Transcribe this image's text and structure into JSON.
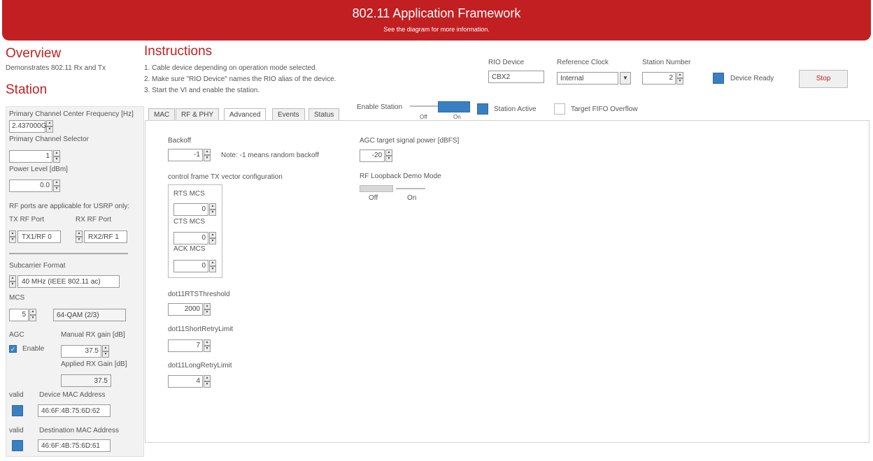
{
  "header": {
    "title": "802.11 Application Framework",
    "subtitle": "See the diagram for more information."
  },
  "overview": {
    "heading": "Overview",
    "description": "Demonstrates 802.11 Rx and Tx"
  },
  "instructions": {
    "heading": "Instructions",
    "steps": [
      "1. Cable device depending on operation mode selected.",
      "2. Make sure \"RIO Device\" names the RIO alias of the device.",
      "3. Start the VI and enable the station."
    ]
  },
  "device": {
    "rio_label": "RIO Device",
    "rio_value": "CBX2",
    "ref_clock_label": "Reference Clock",
    "ref_clock_value": "Internal",
    "station_number_label": "Station Number",
    "station_number_value": "2",
    "device_ready_label": "Device Ready",
    "stop_label": "Stop"
  },
  "station": {
    "heading": "Station",
    "freq_label": "Primary Channel Center Frequency [Hz]",
    "freq_value": "2.437000G",
    "chan_sel_label": "Primary Channel Selector",
    "chan_sel_value": "1",
    "power_label": "Power Level [dBm]",
    "power_value": "0.0",
    "rf_note": "RF ports are applicable for USRP only:",
    "tx_port_label": "TX RF Port",
    "tx_port_value": "TX1/RF 0",
    "rx_port_label": "RX RF Port",
    "rx_port_value": "RX2/RF 1",
    "subcarrier_label": "Subcarrier Format",
    "subcarrier_value": "40 MHz (IEEE 802.11 ac)",
    "mcs_label": "MCS",
    "mcs_value": "5",
    "mcs_desc": "64-QAM (2/3)",
    "agc_label": "AGC",
    "agc_enable_label": "Enable",
    "manual_gain_label": "Manual RX gain [dB]",
    "manual_gain_value": "37.5",
    "applied_gain_label": "Applied RX Gain [dB]",
    "applied_gain_value": "37.5",
    "valid_label_1": "valid",
    "device_mac_label": "Device MAC Address",
    "device_mac_value": "46:6F:4B:75:6D:62",
    "valid_label_2": "valid",
    "dest_mac_label": "Destination MAC Address",
    "dest_mac_value": "46:6F:4B:75:6D:61"
  },
  "tabs": [
    "MAC",
    "RF & PHY",
    "Advanced",
    "Events",
    "Status"
  ],
  "enable_station": {
    "label": "Enable Station",
    "off": "Off",
    "on": "On"
  },
  "status_indicators": {
    "station_active": "Station Active",
    "fifo_overflow": "Target FIFO Overflow"
  },
  "advanced": {
    "backoff_label": "Backoff",
    "backoff_value": "-1",
    "backoff_note": "Note: -1 means random backoff",
    "ctrl_frame_label": "control frame TX vector configuration",
    "rts_mcs_label": "RTS MCS",
    "rts_mcs_value": "0",
    "cts_mcs_label": "CTS MCS",
    "cts_mcs_value": "0",
    "ack_mcs_label": "ACK MCS",
    "ack_mcs_value": "0",
    "rts_threshold_label": "dot11RTSThreshold",
    "rts_threshold_value": "2000",
    "short_retry_label": "dot11ShortRetryLimit",
    "short_retry_value": "7",
    "long_retry_label": "dot11LongRetryLimit",
    "long_retry_value": "4",
    "agc_target_label": "AGC target signal power [dBFS]",
    "agc_target_value": "-20",
    "loopback_label": "RF Loopback Demo Mode",
    "loopback_off": "Off",
    "loopback_on": "On"
  },
  "colors": {
    "brand_red": "#c11f22",
    "led_blue": "#3a7fc1"
  }
}
